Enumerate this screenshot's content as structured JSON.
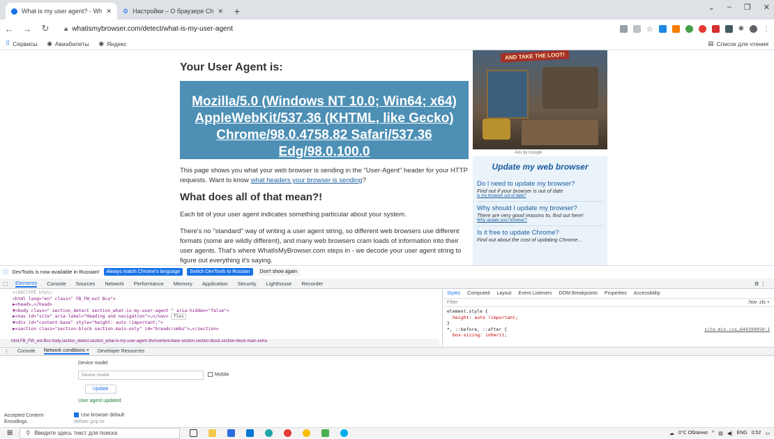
{
  "tabs": [
    {
      "title": "What is my user agent? - WhatIsMyBrowser",
      "active": true
    },
    {
      "title": "Настройки – О браузере Chrome",
      "active": false
    }
  ],
  "address": {
    "url": "whatismybrowser.com/detect/what-is-my-user-agent"
  },
  "bookmarks": [
    "Сервисы",
    "Авиабилеты",
    "Яндекс"
  ],
  "bookmarks_right": "Список для чтения",
  "page": {
    "heading": "Your User Agent is:",
    "ua_string": "Mozilla/5.0 (Windows NT 10.0; Win64; x64) AppleWebKit/537.36 (KHTML, like Gecko) Chrome/98.0.4758.82 Safari/537.36 Edg/98.0.100.0",
    "para1_start": "This page shows you what your web browser is sending in the \"User-Agent\" header for your HTTP requests. Want to know ",
    "para1_link": "what headers your browser is sending",
    "para1_end": "?",
    "heading2": "What does all of that mean?!",
    "para2": "Each bit of your user agent indicates something particular about your system.",
    "para3": "There's no \"standard\" way of writing a user agent string, so different web browsers use different formats (some are wildly different), and many web browsers cram loads of information into their user agents. That's where WhatIsMyBrowser.com steps in - we decode your user agent string to figure out everything it's saying."
  },
  "ad": {
    "headline": "AND TAKE THE LOOT!",
    "label": "Ads by Google"
  },
  "sidebar": {
    "title": "Update my web browser",
    "items": [
      {
        "q": "Do I need to update my browser?",
        "a": "Find out if your browser is out of date",
        "link": "Is my browser out of date?"
      },
      {
        "q": "Why should I update my browser?",
        "a": "There are very good reasons to, find out here!",
        "link": "Why update your browser?"
      },
      {
        "q": "Is it free to update Chrome?",
        "a": "Find out about the cost of updating Chrome..."
      }
    ]
  },
  "devtools_notice": {
    "text": "DevTools is now available in Russian!",
    "b1": "Always match Chrome's language",
    "b2": "Switch DevTools to Russian",
    "b3": "Don't show again"
  },
  "devtools_tabs": [
    "Elements",
    "Console",
    "Sources",
    "Network",
    "Performance",
    "Memory",
    "Application",
    "Security",
    "Lighthouse",
    "Recorder"
  ],
  "elements_lines": {
    "l1": "<!DOCTYPE html>",
    "l2": "<html lang=\"en\" class=\" FB_FW_ext Bco\">",
    "l3": "▶<head>…</head>",
    "l4": "▼<body class=\" section_detect section_what-is-my-user-agent   \" aria-hidden=\"false\">",
    "l5": "  ▶<nav id=\"site\" aria-label=\"Heading and navigation\">…</nav>",
    "l5b": "flex",
    "l6": "  ▼<div id=\"content-base\" style=\"height: auto !important;\">",
    "l7": "    ▶<section class=\"section-block section-main-only\" id=\"breadcrumbs\">…</section>"
  },
  "breadcrumbs": "html.FB_FW_ext.Bco   body.section_detect.section_what-is-my-user-agent   div#content-base   section.section-block.section-block-main-extra",
  "styles_tabs": [
    "Styles",
    "Computed",
    "Layout",
    "Event Listeners",
    "DOM Breakpoints",
    "Properties",
    "Accessibility"
  ],
  "styles": {
    "filter": "Filter",
    "tools": ":hov  .cls  +",
    "rule1": "element.style {",
    "decl1": "height: auto !important;",
    "close": "}",
    "rule2": "*, ::before, ::after {",
    "src2": "site.min.css…644399050:1",
    "decl2": "box-sizing: inherit;"
  },
  "drawer_tabs": [
    "Console",
    "Network conditions ×",
    "Developer Resources"
  ],
  "netcond": {
    "model_label": "Device model",
    "model_placeholder": "Device model",
    "mobile": "Mobile",
    "update": "Update",
    "status": "User agent updated.",
    "accepted": "Accepted Content-Encodings",
    "use_default": "Use browser default",
    "encodings": "deflate   gzip   br"
  },
  "taskbar": {
    "search": "Введите здесь текст для поиска",
    "weather": "0°C  Облачно",
    "lang": "ENG",
    "time": "0:52"
  }
}
